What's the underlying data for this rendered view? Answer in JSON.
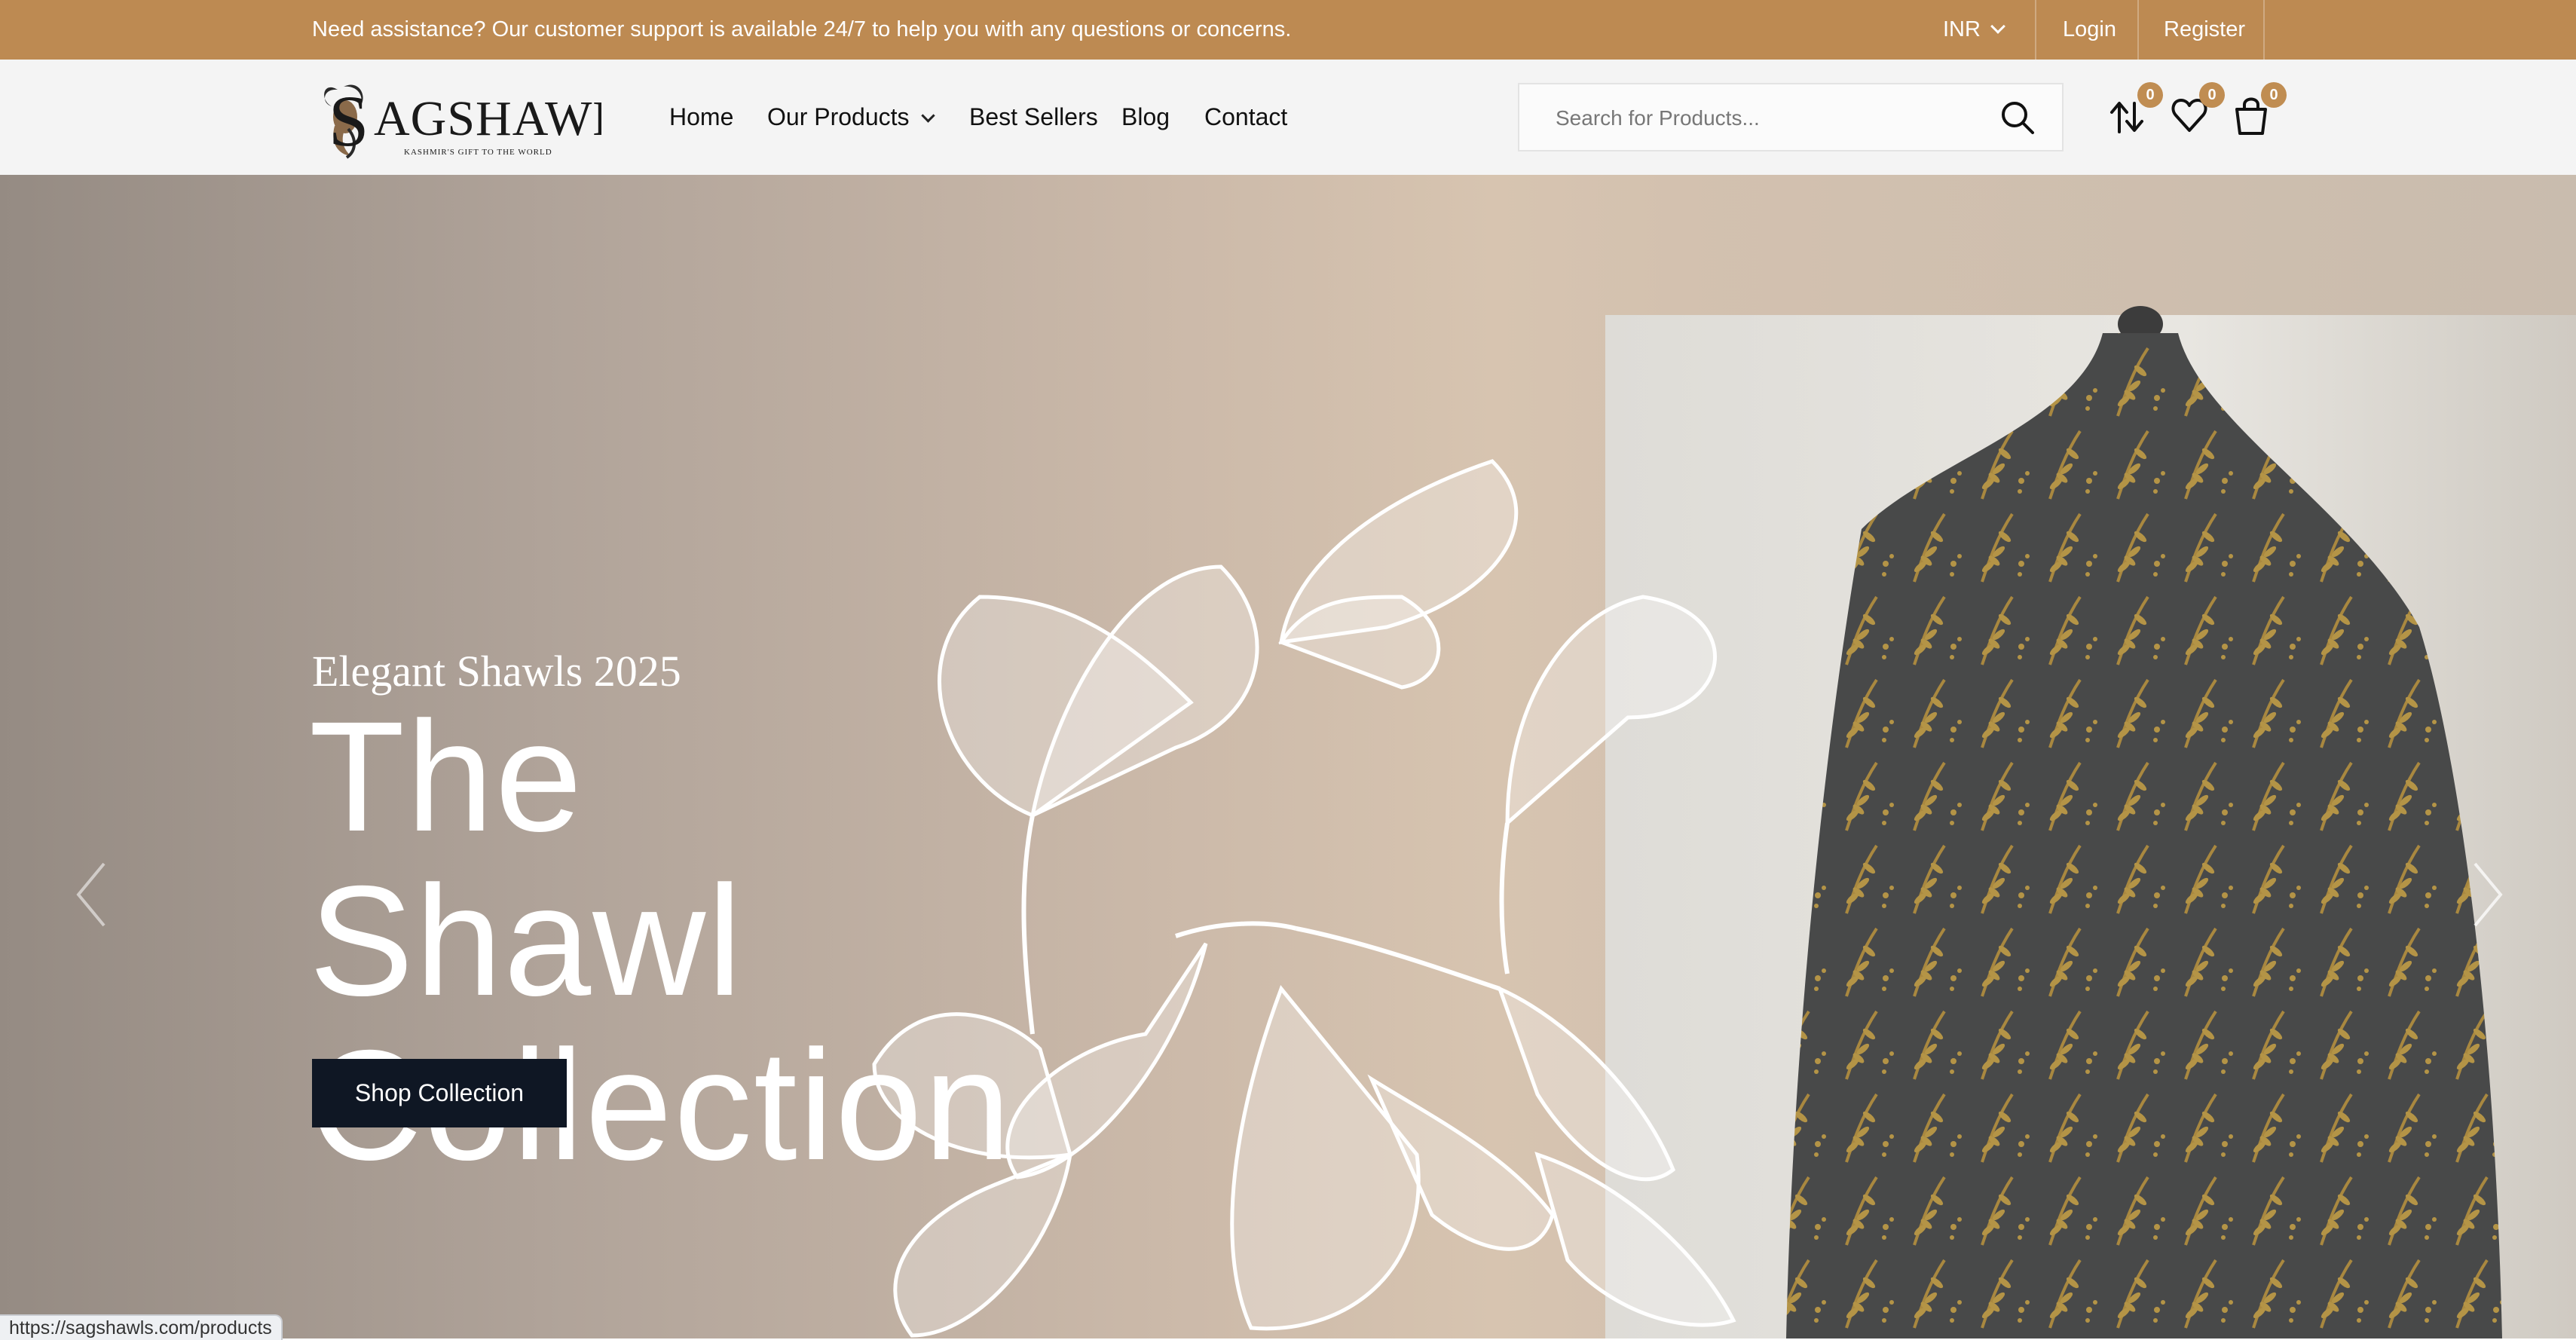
{
  "topbar": {
    "message": "Need assistance? Our customer support is available 24/7 to help you with any questions or concerns.",
    "currency": "INR",
    "login": "Login",
    "register": "Register"
  },
  "brand": {
    "name": "AGSHAWLS",
    "initial": "S",
    "tagline": "KASHMIR'S GIFT TO THE WORLD"
  },
  "nav": {
    "items": [
      "Home",
      "Our Products",
      "Best Sellers",
      "Blog",
      "Contact"
    ]
  },
  "search": {
    "placeholder": "Search for Products..."
  },
  "header_icons": {
    "compare_count": "0",
    "wishlist_count": "0",
    "cart_count": "0"
  },
  "hero": {
    "subtitle": "Elegant Shawls 2025",
    "title_line1": "The Shawl",
    "title_line2": "Collection",
    "cta": "Shop Collection"
  },
  "status_bar": {
    "url": "https://sagshawls.com/products"
  },
  "colors": {
    "topbar": "#bd8a52",
    "badge": "#c08d52",
    "cta": "#0f1724",
    "header_bg": "#f4f4f4"
  }
}
